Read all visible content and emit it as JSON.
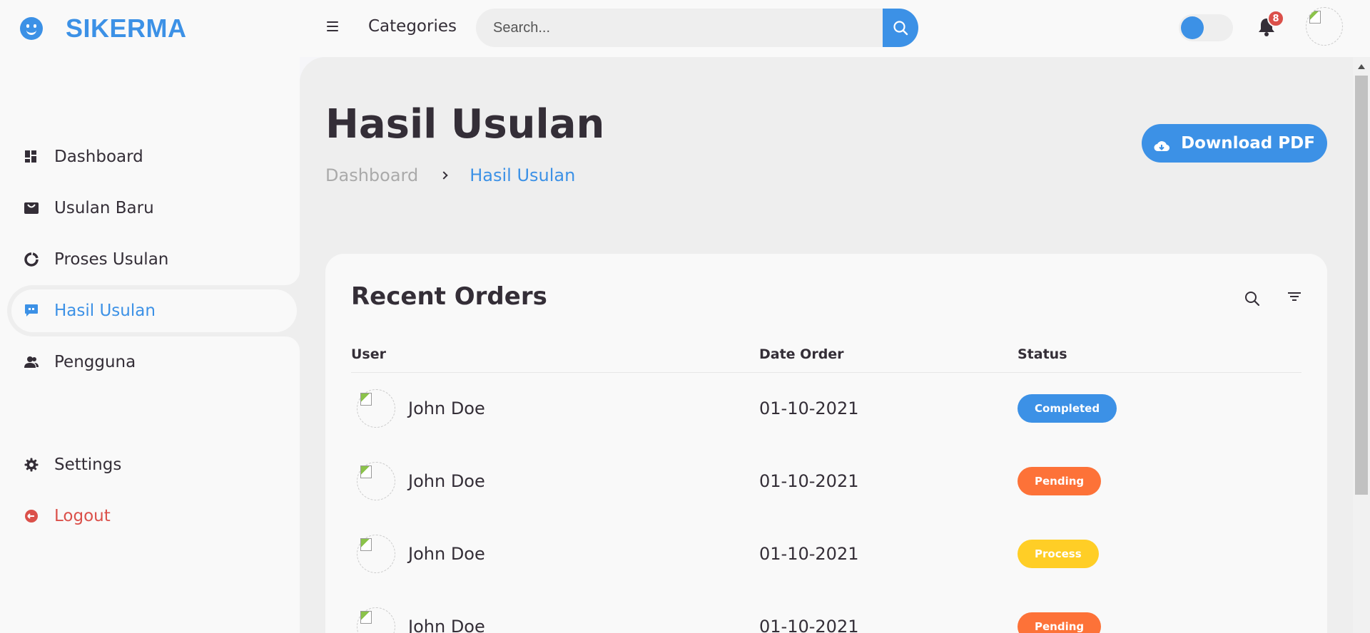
{
  "brand": {
    "name": "SIKERMA",
    "logo_icon": "smile-icon"
  },
  "sidebar": {
    "items": [
      {
        "label": "Dashboard",
        "icon": "dashboard-icon",
        "active": false
      },
      {
        "label": "Usulan Baru",
        "icon": "shopping-bag-icon",
        "active": false
      },
      {
        "label": "Proses Usulan",
        "icon": "doughnut-chart-icon",
        "active": false
      },
      {
        "label": "Hasil Usulan",
        "icon": "message-dots-icon",
        "active": true
      },
      {
        "label": "Pengguna",
        "icon": "group-icon",
        "active": false
      }
    ],
    "bottom": [
      {
        "label": "Settings",
        "icon": "gear-icon"
      },
      {
        "label": "Logout",
        "icon": "logout-icon"
      }
    ]
  },
  "navbar": {
    "menu_icon": "hamburger-icon",
    "link": "Categories",
    "search_placeholder": "Search...",
    "search_icon": "search-icon",
    "notification_count": "8",
    "notification_icon": "bell-icon"
  },
  "page": {
    "title": "Hasil Usulan",
    "breadcrumb": {
      "home": "Dashboard",
      "current": "Hasil Usulan"
    },
    "download_label": "Download PDF",
    "download_icon": "cloud-download-icon"
  },
  "orders": {
    "title": "Recent Orders",
    "headers": {
      "user": "User",
      "date": "Date Order",
      "status": "Status"
    },
    "rows": [
      {
        "user": "John Doe",
        "date": "01-10-2021",
        "status": "Completed",
        "status_color": "#3c91e6"
      },
      {
        "user": "John Doe",
        "date": "01-10-2021",
        "status": "Pending",
        "status_color": "#fd7238"
      },
      {
        "user": "John Doe",
        "date": "01-10-2021",
        "status": "Process",
        "status_color": "#ffce26"
      },
      {
        "user": "John Doe",
        "date": "01-10-2021",
        "status": "Pending",
        "status_color": "#fd7238"
      }
    ]
  },
  "colors": {
    "accent": "#3c91e6",
    "danger": "#db504a",
    "orange": "#fd7238",
    "yellow": "#ffce26"
  }
}
